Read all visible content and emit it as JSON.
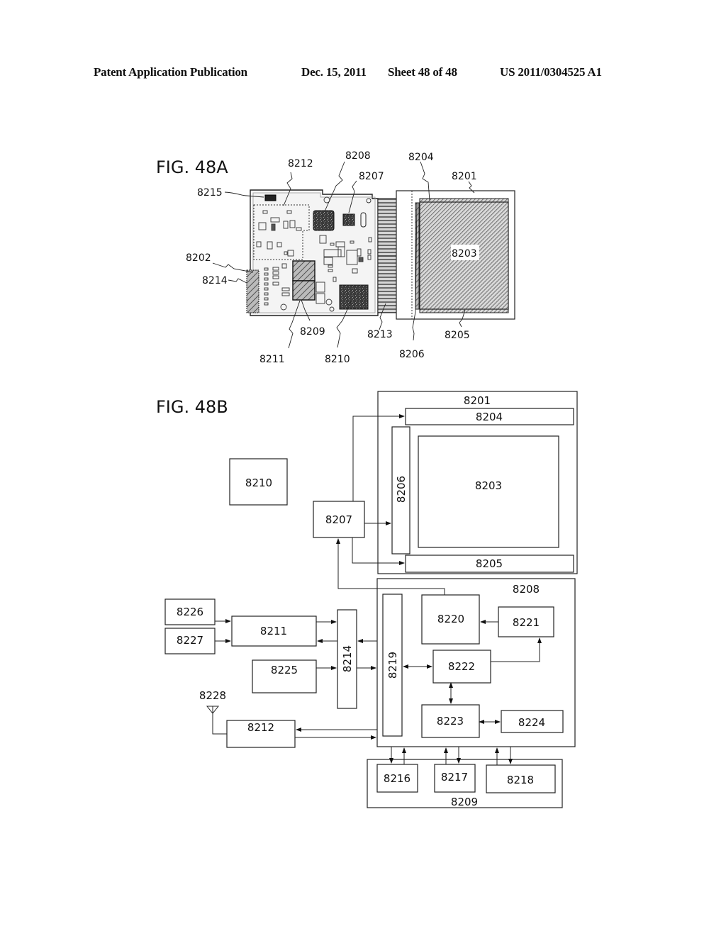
{
  "header": {
    "publication": "Patent Application Publication",
    "date": "Dec. 15, 2011",
    "sheet": "Sheet 48 of 48",
    "pub_number": "US 2011/0304525 A1"
  },
  "fig48a": {
    "title": "FIG. 48A",
    "labels": {
      "l8201": "8201",
      "l8202": "8202",
      "l8203": "8203",
      "l8204": "8204",
      "l8205": "8205",
      "l8206": "8206",
      "l8207": "8207",
      "l8208": "8208",
      "l8209": "8209",
      "l8210": "8210",
      "l8211": "8211",
      "l8212": "8212",
      "l8213": "8213",
      "l8214": "8214",
      "l8215": "8215"
    }
  },
  "fig48b": {
    "title": "FIG. 48B",
    "blocks": {
      "b8201": "8201",
      "b8203": "8203",
      "b8204": "8204",
      "b8205": "8205",
      "b8206": "8206",
      "b8207": "8207",
      "b8208": "8208",
      "b8209": "8209",
      "b8210": "8210",
      "b8211": "8211",
      "b8212": "8212",
      "b8214": "8214",
      "b8216": "8216",
      "b8217": "8217",
      "b8218": "8218",
      "b8219": "8219",
      "b8220": "8220",
      "b8221": "8221",
      "b8222": "8222",
      "b8223": "8223",
      "b8224": "8224",
      "b8225": "8225",
      "b8226": "8226",
      "b8227": "8227",
      "b8228": "8228"
    }
  }
}
